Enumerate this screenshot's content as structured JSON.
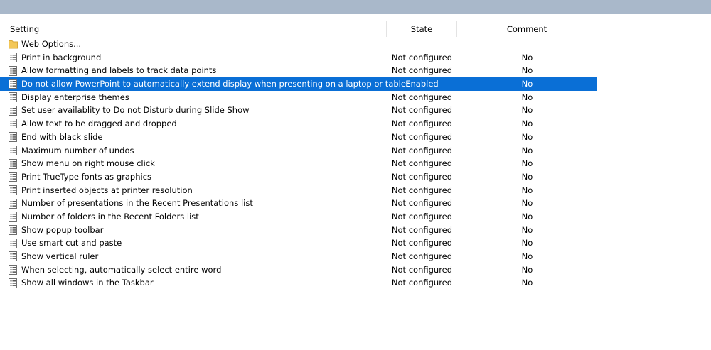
{
  "colors": {
    "top_strip": "#a9b8ca",
    "selection": "#0a6fd6",
    "folder": "#f3c757"
  },
  "columns": {
    "setting": "Setting",
    "state": "State",
    "comment": "Comment"
  },
  "folder": {
    "label": "Web Options...",
    "icon": "folder-icon"
  },
  "rows": [
    {
      "setting": "Print in background",
      "state": "Not configured",
      "comment": "No",
      "selected": false
    },
    {
      "setting": "Allow formatting and labels to track data points",
      "state": "Not configured",
      "comment": "No",
      "selected": false
    },
    {
      "setting": "Do not allow PowerPoint to automatically extend display when presenting on a laptop or tablet",
      "state": "Enabled",
      "comment": "No",
      "selected": true
    },
    {
      "setting": "Display enterprise themes",
      "state": "Not configured",
      "comment": "No",
      "selected": false
    },
    {
      "setting": "Set user availablity to Do not Disturb during Slide Show",
      "state": "Not configured",
      "comment": "No",
      "selected": false
    },
    {
      "setting": "Allow text to be dragged and dropped",
      "state": "Not configured",
      "comment": "No",
      "selected": false
    },
    {
      "setting": "End with black slide",
      "state": "Not configured",
      "comment": "No",
      "selected": false
    },
    {
      "setting": "Maximum number of undos",
      "state": "Not configured",
      "comment": "No",
      "selected": false
    },
    {
      "setting": "Show menu on right mouse click",
      "state": "Not configured",
      "comment": "No",
      "selected": false
    },
    {
      "setting": "Print TrueType fonts as graphics",
      "state": "Not configured",
      "comment": "No",
      "selected": false
    },
    {
      "setting": "Print inserted objects at printer resolution",
      "state": "Not configured",
      "comment": "No",
      "selected": false
    },
    {
      "setting": "Number of presentations in the Recent Presentations list",
      "state": "Not configured",
      "comment": "No",
      "selected": false
    },
    {
      "setting": "Number of folders in the Recent Folders list",
      "state": "Not configured",
      "comment": "No",
      "selected": false
    },
    {
      "setting": "Show popup toolbar",
      "state": "Not configured",
      "comment": "No",
      "selected": false
    },
    {
      "setting": "Use smart cut and paste",
      "state": "Not configured",
      "comment": "No",
      "selected": false
    },
    {
      "setting": "Show vertical ruler",
      "state": "Not configured",
      "comment": "No",
      "selected": false
    },
    {
      "setting": "When selecting, automatically select entire word",
      "state": "Not configured",
      "comment": "No",
      "selected": false
    },
    {
      "setting": "Show all windows in the Taskbar",
      "state": "Not configured",
      "comment": "No",
      "selected": false
    }
  ]
}
